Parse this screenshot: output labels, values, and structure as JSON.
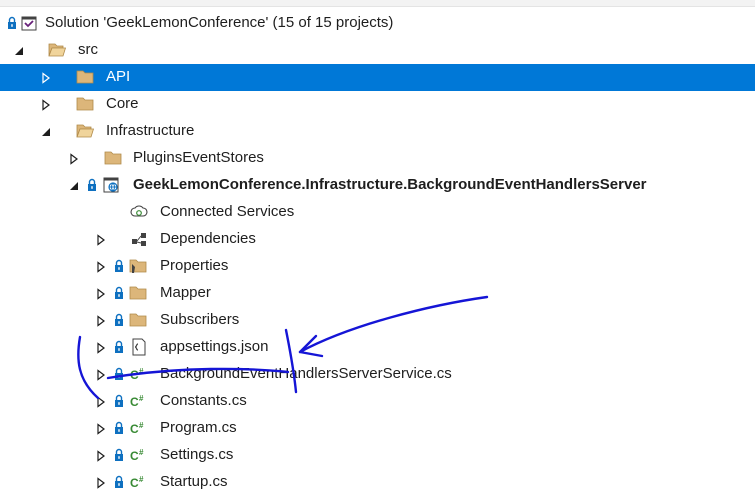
{
  "solution": {
    "label": "Solution 'GeekLemonConference' (15 of 15 projects)"
  },
  "src": {
    "label": "src"
  },
  "api": {
    "label": "API"
  },
  "core": {
    "label": "Core"
  },
  "infrastructure": {
    "label": "Infrastructure"
  },
  "plugins": {
    "label": "PluginsEventStores"
  },
  "project": {
    "label": "GeekLemonConference.Infrastructure.BackgroundEventHandlersServer"
  },
  "connected": {
    "label": "Connected Services"
  },
  "dependencies": {
    "label": "Dependencies"
  },
  "properties": {
    "label": "Properties"
  },
  "mapper": {
    "label": "Mapper"
  },
  "subscribers": {
    "label": "Subscribers"
  },
  "appsettings": {
    "label": "appsettings.json"
  },
  "bgservice": {
    "label": "BackgroundEventHandlersServerService.cs"
  },
  "constants": {
    "label": "Constants.cs"
  },
  "program": {
    "label": "Program.cs"
  },
  "settings": {
    "label": "Settings.cs"
  },
  "startup": {
    "label": "Startup.cs"
  },
  "colors": {
    "selection": "#0078d7",
    "folder": "#dcb67a",
    "csharp": "#388a34",
    "annotation": "#1515d6"
  },
  "icons": {
    "folder": "folder-icon",
    "folder-open": "folder-open-icon",
    "csharp-file": "csharp-file-icon",
    "json-file": "json-file-icon",
    "solution": "solution-icon",
    "project": "project-icon",
    "lock": "lock-icon"
  }
}
